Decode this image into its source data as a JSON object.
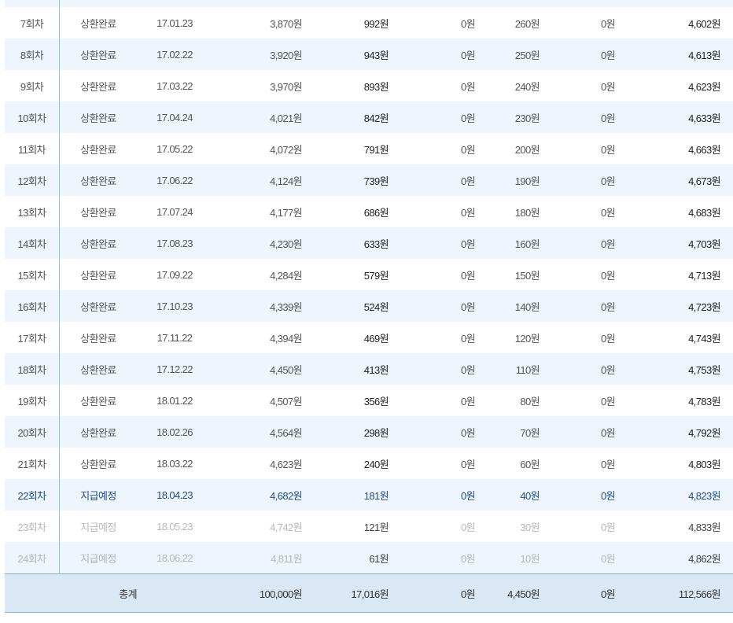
{
  "rows": [
    {
      "no": "7회차",
      "status": "상환완료",
      "date": "17.01.23",
      "principal": "3,870원",
      "interest": "992원",
      "overdue": "0원",
      "fee": "260원",
      "tax": "0원",
      "total": "4,602원"
    },
    {
      "no": "8회차",
      "status": "상환완료",
      "date": "17.02.22",
      "principal": "3,920원",
      "interest": "943원",
      "overdue": "0원",
      "fee": "250원",
      "tax": "0원",
      "total": "4,613원"
    },
    {
      "no": "9회차",
      "status": "상환완료",
      "date": "17.03.22",
      "principal": "3,970원",
      "interest": "893원",
      "overdue": "0원",
      "fee": "240원",
      "tax": "0원",
      "total": "4,623원"
    },
    {
      "no": "10회차",
      "status": "상환완료",
      "date": "17.04.24",
      "principal": "4,021원",
      "interest": "842원",
      "overdue": "0원",
      "fee": "230원",
      "tax": "0원",
      "total": "4,633원"
    },
    {
      "no": "11회차",
      "status": "상환완료",
      "date": "17.05.22",
      "principal": "4,072원",
      "interest": "791원",
      "overdue": "0원",
      "fee": "200원",
      "tax": "0원",
      "total": "4,663원"
    },
    {
      "no": "12회차",
      "status": "상환완료",
      "date": "17.06.22",
      "principal": "4,124원",
      "interest": "739원",
      "overdue": "0원",
      "fee": "190원",
      "tax": "0원",
      "total": "4,673원"
    },
    {
      "no": "13회차",
      "status": "상환완료",
      "date": "17.07.24",
      "principal": "4,177원",
      "interest": "686원",
      "overdue": "0원",
      "fee": "180원",
      "tax": "0원",
      "total": "4,683원"
    },
    {
      "no": "14회차",
      "status": "상환완료",
      "date": "17.08.23",
      "principal": "4,230원",
      "interest": "633원",
      "overdue": "0원",
      "fee": "160원",
      "tax": "0원",
      "total": "4,703원"
    },
    {
      "no": "15회차",
      "status": "상환완료",
      "date": "17.09.22",
      "principal": "4,284원",
      "interest": "579원",
      "overdue": "0원",
      "fee": "150원",
      "tax": "0원",
      "total": "4,713원"
    },
    {
      "no": "16회차",
      "status": "상환완료",
      "date": "17.10.23",
      "principal": "4,339원",
      "interest": "524원",
      "overdue": "0원",
      "fee": "140원",
      "tax": "0원",
      "total": "4,723원"
    },
    {
      "no": "17회차",
      "status": "상환완료",
      "date": "17.11.22",
      "principal": "4,394원",
      "interest": "469원",
      "overdue": "0원",
      "fee": "120원",
      "tax": "0원",
      "total": "4,743원"
    },
    {
      "no": "18회차",
      "status": "상환완료",
      "date": "17.12.22",
      "principal": "4,450원",
      "interest": "413원",
      "overdue": "0원",
      "fee": "110원",
      "tax": "0원",
      "total": "4,753원"
    },
    {
      "no": "19회차",
      "status": "상환완료",
      "date": "18.01.22",
      "principal": "4,507원",
      "interest": "356원",
      "overdue": "0원",
      "fee": "80원",
      "tax": "0원",
      "total": "4,783원"
    },
    {
      "no": "20회차",
      "status": "상환완료",
      "date": "18.02.26",
      "principal": "4,564원",
      "interest": "298원",
      "overdue": "0원",
      "fee": "70원",
      "tax": "0원",
      "total": "4,792원"
    },
    {
      "no": "21회차",
      "status": "상환완료",
      "date": "18.03.22",
      "principal": "4,623원",
      "interest": "240원",
      "overdue": "0원",
      "fee": "60원",
      "tax": "0원",
      "total": "4,803원"
    },
    {
      "no": "22회차",
      "status": "지급예정",
      "date": "18.04.23",
      "principal": "4,682원",
      "interest": "181원",
      "overdue": "0원",
      "fee": "40원",
      "tax": "0원",
      "total": "4,823원"
    },
    {
      "no": "23회차",
      "status": "지급예정",
      "date": "18.05.23",
      "principal": "4,742원",
      "interest": "121원",
      "overdue": "0원",
      "fee": "30원",
      "tax": "0원",
      "total": "4,833원"
    },
    {
      "no": "24회차",
      "status": "지급예정",
      "date": "18.06.22",
      "principal": "4,811원",
      "interest": "61원",
      "overdue": "0원",
      "fee": "10원",
      "tax": "0원",
      "total": "4,862원"
    }
  ],
  "totals": {
    "label": "총계",
    "principal": "100,000원",
    "interest": "17,016원",
    "overdue": "0원",
    "fee": "4,450원",
    "tax": "0원",
    "total": "112,566원"
  }
}
